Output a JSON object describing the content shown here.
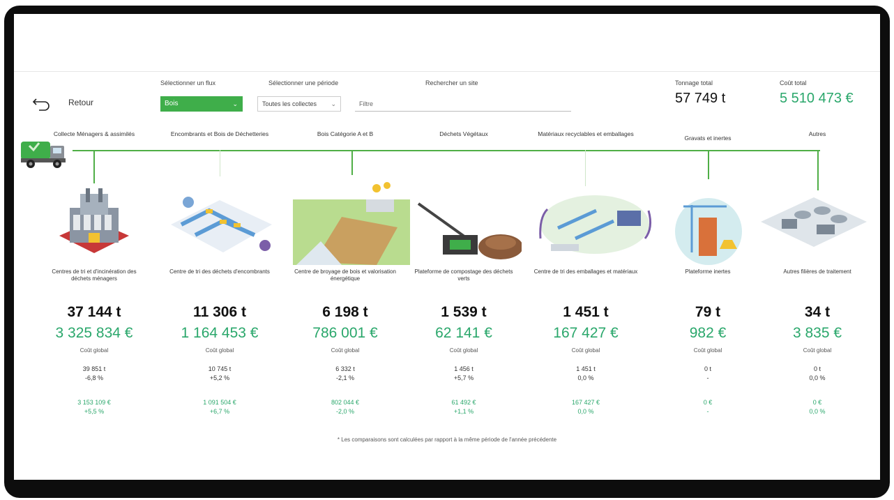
{
  "header": {
    "back_label": "Retour",
    "filter1_label": "Sélectionner un flux",
    "filter1_value": "Bois",
    "filter2_label": "Sélectionner une période",
    "filter2_value": "Toutes les collectes",
    "filter3_label": "Rechercher un site",
    "search_placeholder": "Filtre",
    "kpi_tonnage_label": "Tonnage total",
    "kpi_tonnage_value": "57 749 t",
    "kpi_value_label": "Coût total",
    "kpi_value_value": "5 510 473 €"
  },
  "colors": {
    "accent": "#3fae4a",
    "money": "#2aa76b"
  },
  "stages": [
    {
      "stage": "Collecte Ménagers & assimilés",
      "desc": "Centres de tri et d'incinération des déchets ménagers",
      "ton": "37 144 t",
      "eur": "3 325 834 €",
      "sub": "Coût global",
      "pair1": [
        "39 851 t",
        "-6,8 %"
      ],
      "pair2": [
        "3 153 109 €",
        "+5,5 %"
      ]
    },
    {
      "stage": "Encombrants et Bois de Déchetteries",
      "desc": "Centre de tri des déchets d'encombrants",
      "ton": "11 306 t",
      "eur": "1 164 453 €",
      "sub": "Coût global",
      "pair1": [
        "10 745 t",
        "+5,2 %"
      ],
      "pair2": [
        "1 091 504 €",
        "+6,7 %"
      ]
    },
    {
      "stage": "Bois Catégorie A et B",
      "desc": "Centre de broyage de bois et valorisation énergétique",
      "ton": "6 198 t",
      "eur": "786 001 €",
      "sub": "Coût global",
      "pair1": [
        "6 332 t",
        "-2,1 %"
      ],
      "pair2": [
        "802 044 €",
        "-2,0 %"
      ]
    },
    {
      "stage": "Déchets Végétaux",
      "desc": "Plateforme de compostage des déchets verts",
      "ton": "1 539 t",
      "eur": "62 141 €",
      "sub": "Coût global",
      "pair1": [
        "1 456 t",
        "+5,7 %"
      ],
      "pair2": [
        "61 492 €",
        "+1,1 %"
      ]
    },
    {
      "stage": "Matériaux recyclables et emballages",
      "desc": "Centre de tri des emballages et matériaux",
      "ton": "1 451 t",
      "eur": "167 427 €",
      "sub": "Coût global",
      "pair1": [
        "1 451 t",
        "0,0 %"
      ],
      "pair2": [
        "167 427 €",
        "0,0 %"
      ]
    },
    {
      "stage": "Gravats et inertes",
      "desc": "Plateforme inertes",
      "ton": "79 t",
      "eur": "982 €",
      "sub": "Coût global",
      "pair1": [
        "0 t",
        "-",
        "-"
      ],
      "pair2": [
        "0 €",
        "-"
      ]
    },
    {
      "stage": "Autres",
      "desc": "Autres filières de traitement",
      "ton": "34 t",
      "eur": "3 835 €",
      "sub": "Coût global",
      "pair1": [
        "0 t",
        "0,0 %"
      ],
      "pair2": [
        "0 €",
        "0,0 %"
      ]
    }
  ],
  "footnote": "* Les comparaisons sont calculées par rapport à la même période de l'année précédente"
}
